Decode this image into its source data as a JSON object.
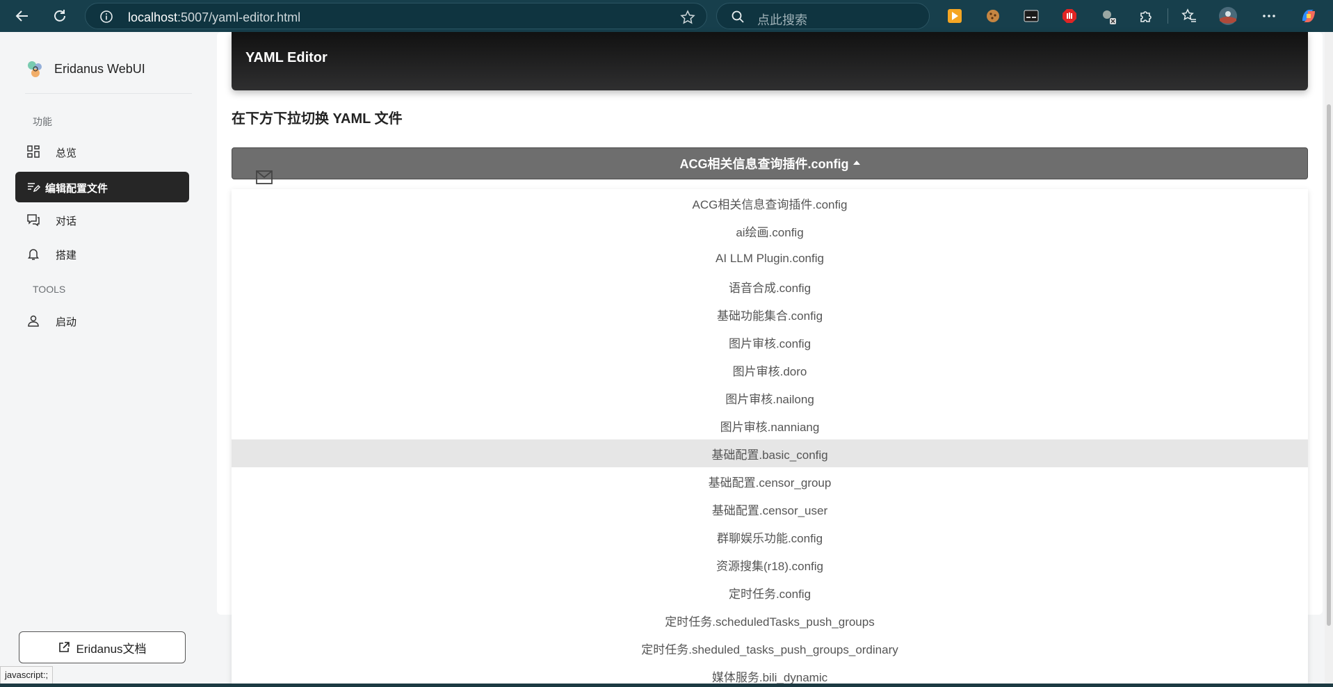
{
  "browser": {
    "url_host": "localhost",
    "url_rest": ":5007/yaml-editor.html",
    "search_placeholder": "点此搜索"
  },
  "sidebar": {
    "brand": "Eridanus WebUI",
    "section_features": "功能",
    "items": [
      {
        "label": "总览",
        "icon": "grid-icon"
      },
      {
        "label": "编辑配置文件",
        "icon": "edit-icon"
      },
      {
        "label": "对话",
        "icon": "chat-icon"
      },
      {
        "label": "搭建",
        "icon": "bell-icon"
      }
    ],
    "section_tools": "TOOLS",
    "tools": [
      {
        "label": "启动",
        "icon": "user-icon"
      }
    ],
    "docs_label": "Eridanus文档"
  },
  "status_tip": "javascript:;",
  "main": {
    "header_title": "YAML Editor",
    "hint": "在下方下拉切换 YAML 文件",
    "dropdown_selected": "ACG相关信息查询插件.config",
    "options": [
      "ACG相关信息查询插件.config",
      "ai绘画.config",
      "AI LLM Plugin.config",
      "语音合成.config",
      "基础功能集合.config",
      "图片审核.config",
      "图片审核.doro",
      "图片审核.nailong",
      "图片审核.nanniang",
      "基础配置.basic_config",
      "基础配置.censor_group",
      "基础配置.censor_user",
      "群聊娱乐功能.config",
      "资源搜集(r18).config",
      "定时任务.config",
      "定时任务.scheduledTasks_push_groups",
      "定时任务.sheduled_tasks_push_groups_ordinary",
      "媒体服务.bili_dynamic"
    ],
    "hovered_option": "基础配置.basic_config"
  },
  "colors": {
    "browser_bar": "#173f4c",
    "active_nav": "#262626",
    "dropdown_button": "#6e6e6e"
  }
}
